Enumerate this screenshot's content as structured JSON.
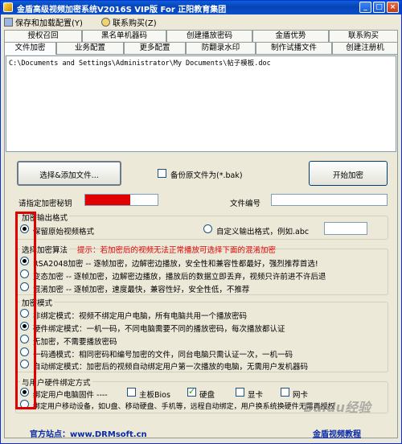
{
  "window": {
    "title": "金盾高级视频加密系统V2016S VIP版 For 正阳教育集团",
    "controls": [
      "_",
      "□",
      "×"
    ]
  },
  "menu": {
    "items": [
      {
        "label": "保存和加载配置(Y)",
        "icon": "disk-icon"
      },
      {
        "label": "联系购买(Z)",
        "icon": "contact-icon"
      }
    ]
  },
  "tabs": {
    "row1": [
      "授权召回",
      "黑名单机器码",
      "创建播放密码",
      "金盾优势",
      "联系购买"
    ],
    "row2": [
      "文件加密",
      "业务配置",
      "更多配置",
      "防翻录水印",
      "制作试播文件",
      "创建注册机"
    ],
    "active": "文件加密"
  },
  "file_list": {
    "items": [
      "C:\\Documents and Settings\\Administrator\\My Documents\\帖子模板.doc"
    ]
  },
  "buttons": {
    "add_files": "选择&添加文件...",
    "start": "开始加密"
  },
  "backup": {
    "label": "备份原文件为(*.bak)",
    "checked": false
  },
  "key": {
    "label": "请指定加密秘钥",
    "strength_color": "#e00000"
  },
  "file_id": {
    "label": "文件编号",
    "value": ""
  },
  "output_format": {
    "title": "加密输出格式",
    "keep_original": "保留原始视频格式",
    "custom": "自定义输出格式，例如.abc",
    "custom_value": ""
  },
  "algorithm": {
    "title": "选择加密算法",
    "hint": "提示：若加密后的视频无法正常播放可选择下面的混淆加密",
    "options": [
      {
        "label": "RSA2048加密 -- 逐帧加密，边解密边播放，安全性和兼容性都最好，强烈推荐首选!",
        "checked": true
      },
      {
        "label": "变态加密 -- 逐帧加密，边解密边播放，播放后的数据立即丢弃，视频只许前进不许后退",
        "checked": false
      },
      {
        "label": "混淆加密 -- 逐帧加密，速度最快，兼容性好，安全性低，不推荐",
        "checked": false
      }
    ]
  },
  "mode": {
    "title": "加密模式",
    "options": [
      {
        "label": "非绑定模式：视频不绑定用户电脑，所有电脑共用一个播放密码",
        "checked": false
      },
      {
        "label": "硬件绑定模式：一机一码，不同电脑需要不同的播放密码，每次播放都认证",
        "checked": true
      },
      {
        "label": "无加密，不需要播放密码",
        "checked": false
      },
      {
        "label": "一码通模式：相同密码和编号加密的文件，同台电脑只需认证一次，一机一码",
        "checked": false
      },
      {
        "label": "自动绑定模式：加密后的视频自动绑定用户第一次播放的电脑，无需用户发机器码",
        "checked": false
      }
    ]
  },
  "hardware": {
    "title": "与用户硬件绑定方式",
    "bind_pc": "绑定用户电脑固件 ----",
    "items": [
      {
        "label": "主板Bios",
        "checked": false
      },
      {
        "label": "硬盘",
        "checked": true
      },
      {
        "label": "显卡",
        "checked": false
      },
      {
        "label": "网卡",
        "checked": false
      }
    ],
    "bind_mobile": "绑定用户移动设备，如U盘、移动硬盘、手机等，远程自动绑定，用户换系统换硬件无需再授权"
  },
  "footer": {
    "site": "官方站点：www.DRMsoft.cn",
    "video": "金盾视频教程"
  },
  "watermark": "Baidu经验"
}
